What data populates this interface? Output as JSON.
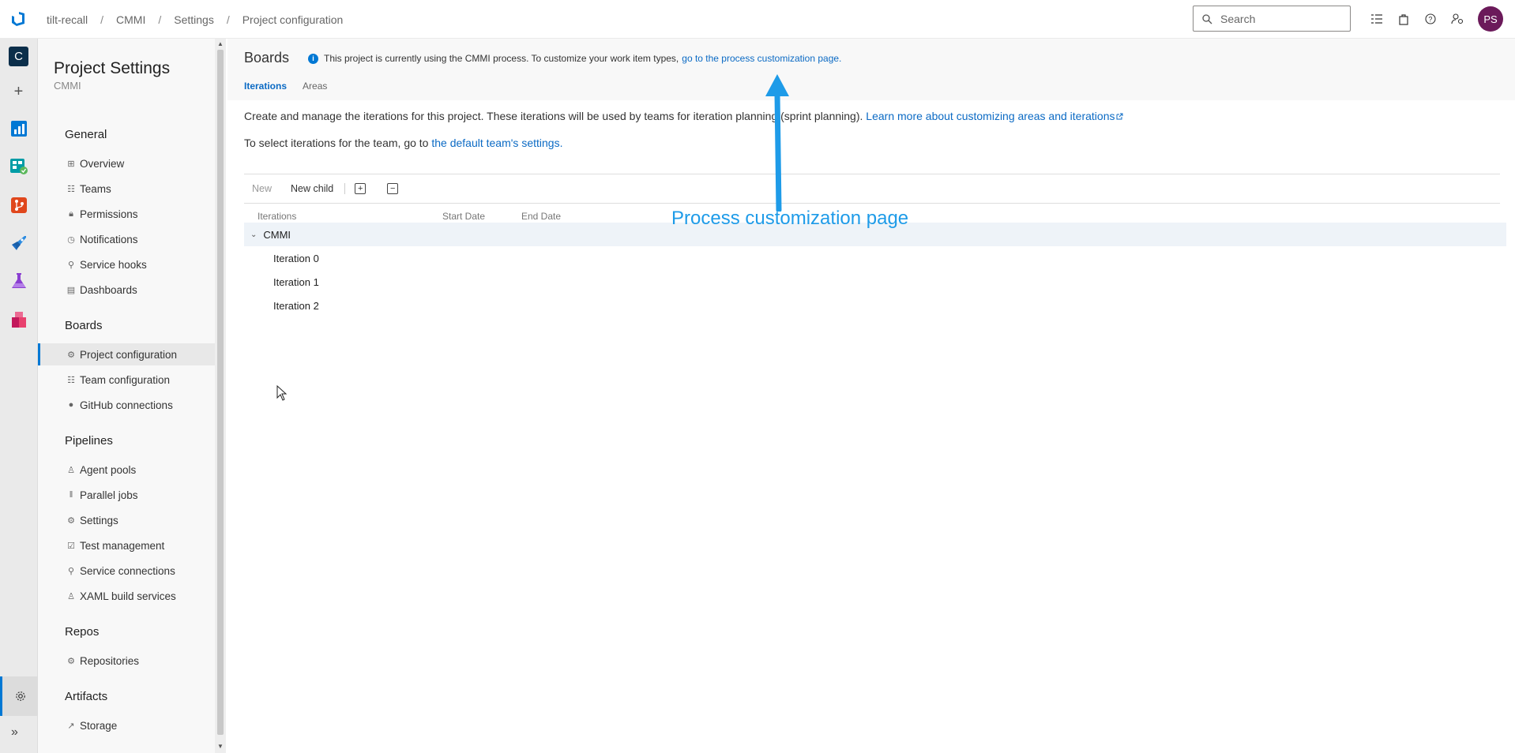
{
  "breadcrumbs": [
    "tilt-recall",
    "CMMI",
    "Settings",
    "Project configuration"
  ],
  "search": {
    "placeholder": "Search"
  },
  "user": {
    "initials": "PS"
  },
  "rail": {
    "project_initial": "C"
  },
  "nav": {
    "title": "Project Settings",
    "subtitle": "CMMI",
    "sections": {
      "general": "General",
      "boards": "Boards",
      "pipelines": "Pipelines",
      "repos": "Repos",
      "artifacts": "Artifacts"
    },
    "items": {
      "overview": "Overview",
      "teams": "Teams",
      "permissions": "Permissions",
      "notifications": "Notifications",
      "service_hooks": "Service hooks",
      "dashboards": "Dashboards",
      "project_configuration": "Project configuration",
      "team_configuration": "Team configuration",
      "github_connections": "GitHub connections",
      "agent_pools": "Agent pools",
      "parallel_jobs": "Parallel jobs",
      "settings": "Settings",
      "test_management": "Test management",
      "service_connections": "Service connections",
      "xaml_build_services": "XAML build services",
      "repositories": "Repositories",
      "storage": "Storage"
    }
  },
  "main": {
    "title": "Boards",
    "banner_text": "This project is currently using the CMMI process. To customize your work item types,",
    "banner_link": "go to the process customization page.",
    "tabs": [
      "Iterations",
      "Areas"
    ],
    "desc1_text": "Create and manage the iterations for this project. These iterations will be used by teams for iteration planning (sprint planning).",
    "desc1_link": "Learn more about customizing areas and iterations",
    "desc2_text": "To select iterations for the team, go to",
    "desc2_link": "the default team's settings.",
    "toolbar": {
      "new": "New",
      "new_child": "New child"
    },
    "columns": [
      "Iterations",
      "Start Date",
      "End Date"
    ],
    "root": "CMMI",
    "iterations": [
      "Iteration 0",
      "Iteration 1",
      "Iteration 2"
    ]
  },
  "annotation": "Process customization page"
}
